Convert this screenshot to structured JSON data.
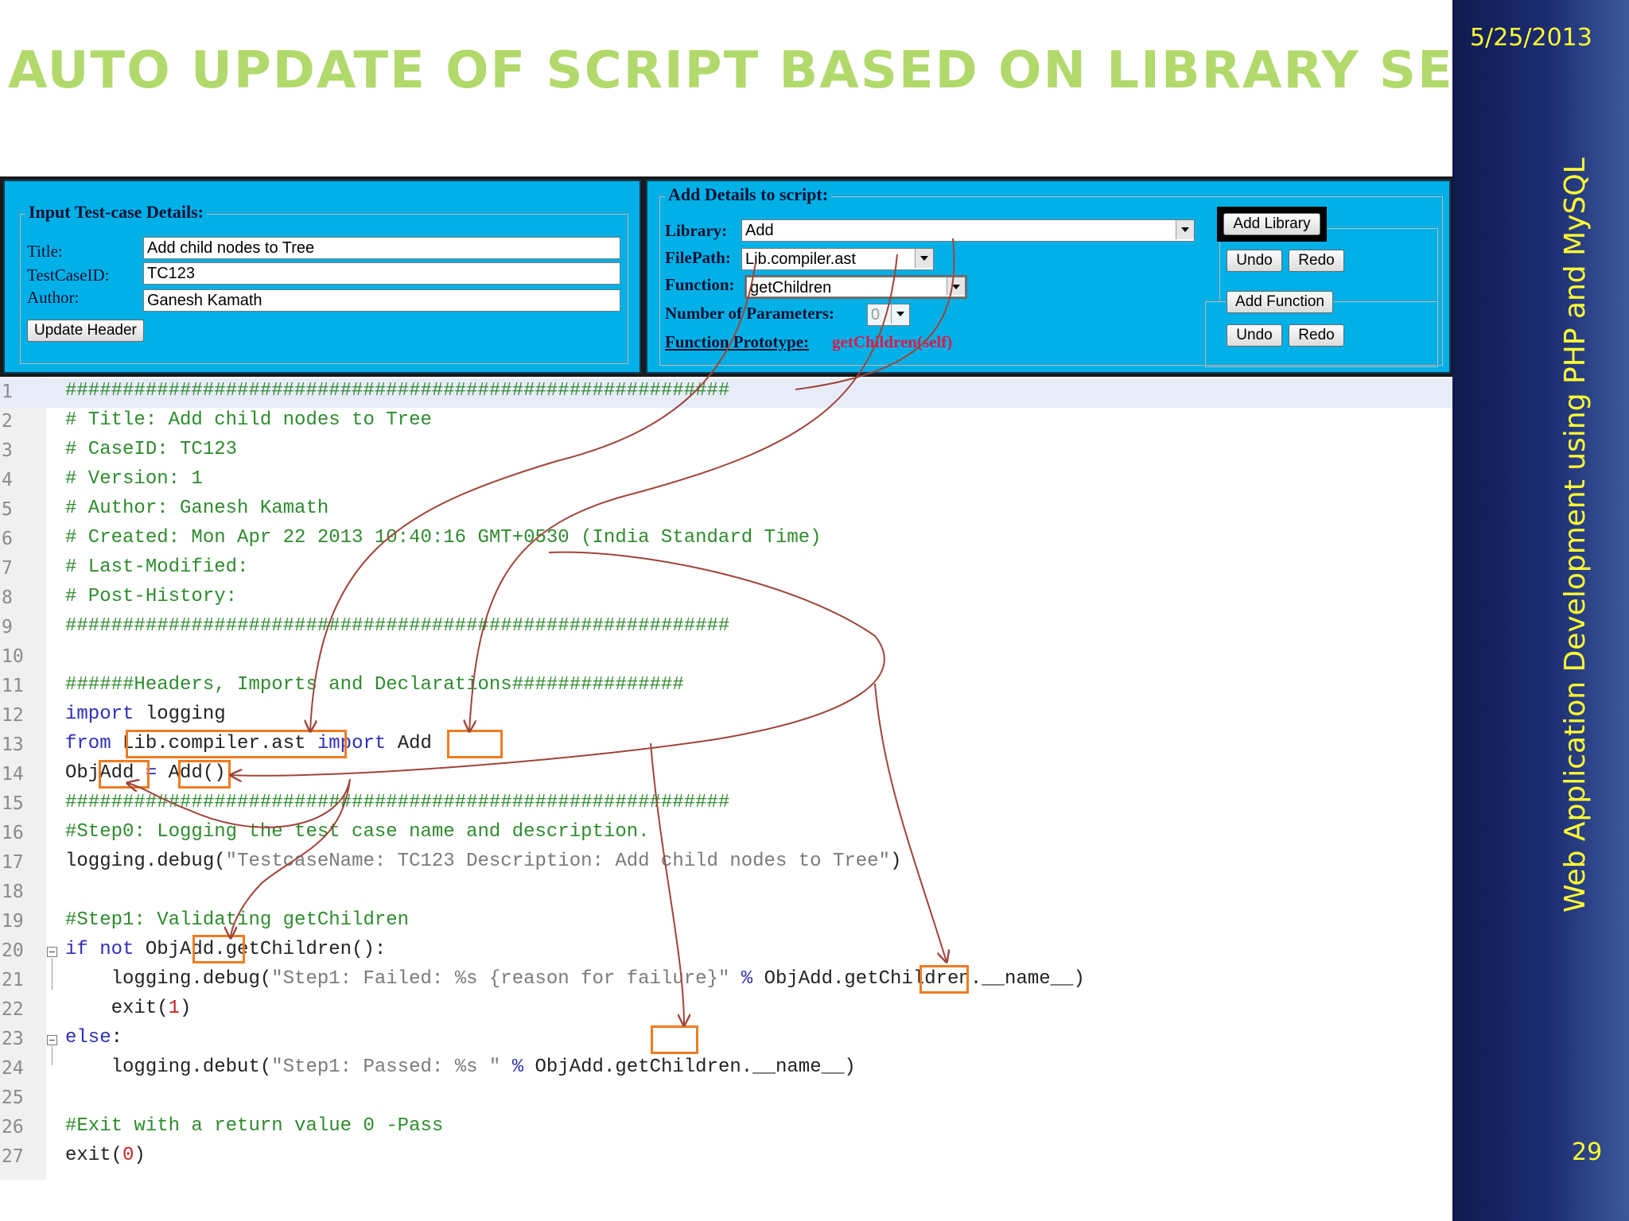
{
  "slide": {
    "title": "Auto update of script based on library selection",
    "date": "5/25/2013",
    "side_text": "Web Application Development using PHP and MySQL",
    "page_number": "29"
  },
  "testcase_panel": {
    "legend": "Input Test-case Details:",
    "title_label": "Title:",
    "title_value": "Add child nodes to Tree",
    "id_label": "TestCaseID:",
    "id_value": "TC123",
    "author_label": "Author:",
    "author_value": "Ganesh Kamath",
    "update_button": "Update Header"
  },
  "script_panel": {
    "legend": "Add Details to script:",
    "library_label": "Library:",
    "library_value": "Add",
    "filepath_label": "FilePath:",
    "filepath_value": "Lib.compiler.ast",
    "function_label": "Function:",
    "function_value": "getChildren",
    "params_label": "Number of Parameters:",
    "params_value": "0",
    "prototype_label": "Function Prototype:",
    "prototype_value": "getChildren(self)",
    "add_library_button": "Add Library",
    "add_function_button": "Add Function",
    "undo_label": "Undo",
    "redo_label": "Redo"
  },
  "code": {
    "line_numbers": [
      "1",
      "2",
      "3",
      "4",
      "5",
      "6",
      "7",
      "8",
      "9",
      "10",
      "11",
      "12",
      "13",
      "14",
      "15",
      "16",
      "17",
      "18",
      "19",
      "20",
      "21",
      "22",
      "23",
      "24",
      "25",
      "26",
      "27"
    ],
    "l1": "##########################################################",
    "l2": "# Title: Add child nodes to Tree",
    "l3": "# CaseID: TC123",
    "l4": "# Version: 1",
    "l5": "# Author: Ganesh Kamath",
    "l6": "# Created: Mon Apr 22 2013 10:40:16 GMT+0530 (India Standard Time)",
    "l7": "# Last-Modified:",
    "l8": "# Post-History:",
    "l9": "##########################################################",
    "l11": "######Headers, Imports and Declarations###############",
    "l12_kw": "import",
    "l12_rest": " logging",
    "l13_kw1": "from",
    "l13_mod": "Lib.compiler.ast",
    "l13_kw2": "import",
    "l13_name": "Add",
    "l14_obj": "Obj",
    "l14_name": "Add",
    "l14_eq": " = ",
    "l14_call": "Add",
    "l14_paren": "()",
    "l15": "##########################################################",
    "l16": "#Step0: Logging the test case name and description.",
    "l17_fn": "logging.debug(",
    "l17_str": "\"TestcaseName: TC123 Description: Add child nodes to Tree\"",
    "l17_end": ")",
    "l19": "#Step1: Validating getChildren",
    "l20_kw": "if not",
    "l20_obj": " Obj",
    "l20_name": "Add",
    "l20_rest": ".getChildren():",
    "l21_fn": "    logging.debug(",
    "l21_str": "\"Step1: Failed: %s {reason for failure}\"",
    "l21_op": " % ",
    "l21_obj": "Obj",
    "l21_name": "Add",
    "l21_rest": ".getChildren.__name__)",
    "l22_fn": "    exit(",
    "l22_num": "1",
    "l22_end": ")",
    "l23_kw": "else",
    "l23_end": ":",
    "l24_fn": "    logging.debut(",
    "l24_str": "\"Step1: Passed: %s \"",
    "l24_op": " % ",
    "l24_obj": "Obj",
    "l24_name": "Add",
    "l24_rest": ".getChildren.__name__)",
    "l26": "#Exit with a return value 0 -Pass",
    "l27_fn": "exit(",
    "l27_num": "0",
    "l27_end": ")"
  },
  "colors": {
    "title": "#b2d96b",
    "panel": "#00b0e6",
    "band": "#1c2d74",
    "highlight_box": "#f07b20",
    "arrow": "#a0443a",
    "prototype": "#e0184a"
  }
}
